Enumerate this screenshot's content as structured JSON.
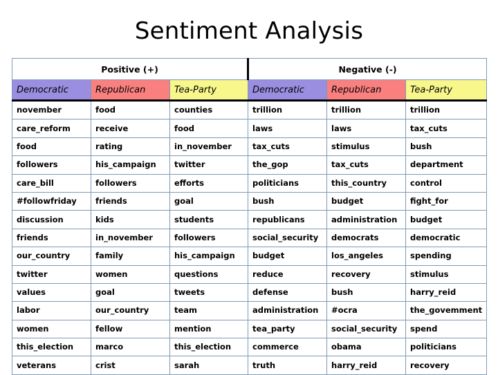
{
  "page_title": "Sentiment Analysis",
  "colors": {
    "democratic": "#9a8ee0",
    "republican": "#fa8080",
    "tea_party": "#f7f78c",
    "grid_line": "#7f99b3",
    "divider": "#000000",
    "text": "#000000",
    "background": "#ffffff"
  },
  "table": {
    "polarity_headers": [
      {
        "label": "Positive (+)",
        "span": 3
      },
      {
        "label": "Negative (-)",
        "span": 3
      }
    ],
    "party_headers": [
      {
        "label": "Democratic",
        "polarity": "positive",
        "color_key": "democratic"
      },
      {
        "label": "Republican",
        "polarity": "positive",
        "color_key": "republican"
      },
      {
        "label": "Tea-Party",
        "polarity": "positive",
        "color_key": "tea_party"
      },
      {
        "label": "Democratic",
        "polarity": "negative",
        "color_key": "democratic"
      },
      {
        "label": "Republican",
        "polarity": "negative",
        "color_key": "republican"
      },
      {
        "label": "Tea-Party",
        "polarity": "negative",
        "color_key": "tea_party"
      }
    ],
    "rows": [
      [
        "november",
        "food",
        "counties",
        "trillion",
        "trillion",
        "trillion"
      ],
      [
        "care_reform",
        "receive",
        "food",
        "laws",
        "laws",
        "tax_cuts"
      ],
      [
        "food",
        "rating",
        "in_november",
        "tax_cuts",
        "stimulus",
        "bush"
      ],
      [
        "followers",
        "his_campaign",
        "twitter",
        "the_gop",
        "tax_cuts",
        "department"
      ],
      [
        "care_bill",
        "followers",
        "efforts",
        "politicians",
        "this_country",
        "control"
      ],
      [
        "#followfriday",
        "friends",
        "goal",
        "bush",
        "budget",
        "fight_for"
      ],
      [
        "discussion",
        "kids",
        "students",
        "republicans",
        "administration",
        "budget"
      ],
      [
        "friends",
        "in_november",
        "followers",
        "social_security",
        "democrats",
        "democratic"
      ],
      [
        "our_country",
        "family",
        "his_campaign",
        "budget",
        "los_angeles",
        "spending"
      ],
      [
        "twitter",
        "women",
        "questions",
        "reduce",
        "recovery",
        "stimulus"
      ],
      [
        "values",
        "goal",
        "tweets",
        "defense",
        "bush",
        "harry_reid"
      ],
      [
        "labor",
        "our_country",
        "team",
        "administration",
        "#ocra",
        "the_govemment"
      ],
      [
        "women",
        "fellow",
        "mention",
        "tea_party",
        "social_security",
        "spend"
      ],
      [
        "this_election",
        "marco",
        "this_election",
        "commerce",
        "obama",
        "politicians"
      ],
      [
        "veterans",
        "crist",
        "sarah",
        "truth",
        "harry_reid",
        "recovery"
      ]
    ]
  }
}
